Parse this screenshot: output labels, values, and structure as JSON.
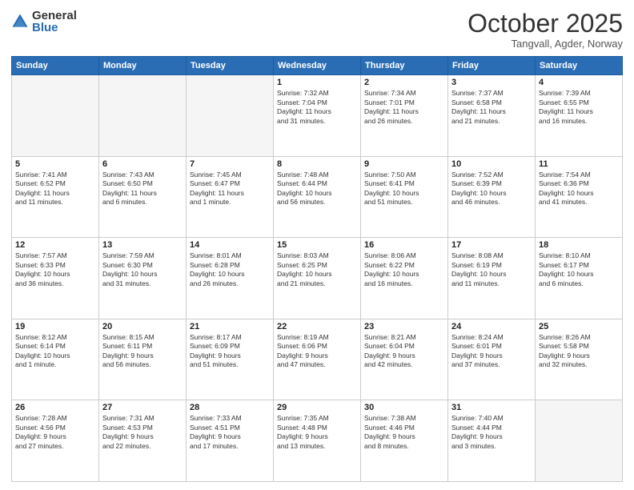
{
  "logo": {
    "general": "General",
    "blue": "Blue"
  },
  "header": {
    "month_year": "October 2025",
    "location": "Tangvall, Agder, Norway"
  },
  "weekdays": [
    "Sunday",
    "Monday",
    "Tuesday",
    "Wednesday",
    "Thursday",
    "Friday",
    "Saturday"
  ],
  "weeks": [
    [
      {
        "day": "",
        "info": ""
      },
      {
        "day": "",
        "info": ""
      },
      {
        "day": "",
        "info": ""
      },
      {
        "day": "1",
        "info": "Sunrise: 7:32 AM\nSunset: 7:04 PM\nDaylight: 11 hours\nand 31 minutes."
      },
      {
        "day": "2",
        "info": "Sunrise: 7:34 AM\nSunset: 7:01 PM\nDaylight: 11 hours\nand 26 minutes."
      },
      {
        "day": "3",
        "info": "Sunrise: 7:37 AM\nSunset: 6:58 PM\nDaylight: 11 hours\nand 21 minutes."
      },
      {
        "day": "4",
        "info": "Sunrise: 7:39 AM\nSunset: 6:55 PM\nDaylight: 11 hours\nand 16 minutes."
      }
    ],
    [
      {
        "day": "5",
        "info": "Sunrise: 7:41 AM\nSunset: 6:52 PM\nDaylight: 11 hours\nand 11 minutes."
      },
      {
        "day": "6",
        "info": "Sunrise: 7:43 AM\nSunset: 6:50 PM\nDaylight: 11 hours\nand 6 minutes."
      },
      {
        "day": "7",
        "info": "Sunrise: 7:45 AM\nSunset: 6:47 PM\nDaylight: 11 hours\nand 1 minute."
      },
      {
        "day": "8",
        "info": "Sunrise: 7:48 AM\nSunset: 6:44 PM\nDaylight: 10 hours\nand 56 minutes."
      },
      {
        "day": "9",
        "info": "Sunrise: 7:50 AM\nSunset: 6:41 PM\nDaylight: 10 hours\nand 51 minutes."
      },
      {
        "day": "10",
        "info": "Sunrise: 7:52 AM\nSunset: 6:39 PM\nDaylight: 10 hours\nand 46 minutes."
      },
      {
        "day": "11",
        "info": "Sunrise: 7:54 AM\nSunset: 6:36 PM\nDaylight: 10 hours\nand 41 minutes."
      }
    ],
    [
      {
        "day": "12",
        "info": "Sunrise: 7:57 AM\nSunset: 6:33 PM\nDaylight: 10 hours\nand 36 minutes."
      },
      {
        "day": "13",
        "info": "Sunrise: 7:59 AM\nSunset: 6:30 PM\nDaylight: 10 hours\nand 31 minutes."
      },
      {
        "day": "14",
        "info": "Sunrise: 8:01 AM\nSunset: 6:28 PM\nDaylight: 10 hours\nand 26 minutes."
      },
      {
        "day": "15",
        "info": "Sunrise: 8:03 AM\nSunset: 6:25 PM\nDaylight: 10 hours\nand 21 minutes."
      },
      {
        "day": "16",
        "info": "Sunrise: 8:06 AM\nSunset: 6:22 PM\nDaylight: 10 hours\nand 16 minutes."
      },
      {
        "day": "17",
        "info": "Sunrise: 8:08 AM\nSunset: 6:19 PM\nDaylight: 10 hours\nand 11 minutes."
      },
      {
        "day": "18",
        "info": "Sunrise: 8:10 AM\nSunset: 6:17 PM\nDaylight: 10 hours\nand 6 minutes."
      }
    ],
    [
      {
        "day": "19",
        "info": "Sunrise: 8:12 AM\nSunset: 6:14 PM\nDaylight: 10 hours\nand 1 minute."
      },
      {
        "day": "20",
        "info": "Sunrise: 8:15 AM\nSunset: 6:11 PM\nDaylight: 9 hours\nand 56 minutes."
      },
      {
        "day": "21",
        "info": "Sunrise: 8:17 AM\nSunset: 6:09 PM\nDaylight: 9 hours\nand 51 minutes."
      },
      {
        "day": "22",
        "info": "Sunrise: 8:19 AM\nSunset: 6:06 PM\nDaylight: 9 hours\nand 47 minutes."
      },
      {
        "day": "23",
        "info": "Sunrise: 8:21 AM\nSunset: 6:04 PM\nDaylight: 9 hours\nand 42 minutes."
      },
      {
        "day": "24",
        "info": "Sunrise: 8:24 AM\nSunset: 6:01 PM\nDaylight: 9 hours\nand 37 minutes."
      },
      {
        "day": "25",
        "info": "Sunrise: 8:26 AM\nSunset: 5:58 PM\nDaylight: 9 hours\nand 32 minutes."
      }
    ],
    [
      {
        "day": "26",
        "info": "Sunrise: 7:28 AM\nSunset: 4:56 PM\nDaylight: 9 hours\nand 27 minutes."
      },
      {
        "day": "27",
        "info": "Sunrise: 7:31 AM\nSunset: 4:53 PM\nDaylight: 9 hours\nand 22 minutes."
      },
      {
        "day": "28",
        "info": "Sunrise: 7:33 AM\nSunset: 4:51 PM\nDaylight: 9 hours\nand 17 minutes."
      },
      {
        "day": "29",
        "info": "Sunrise: 7:35 AM\nSunset: 4:48 PM\nDaylight: 9 hours\nand 13 minutes."
      },
      {
        "day": "30",
        "info": "Sunrise: 7:38 AM\nSunset: 4:46 PM\nDaylight: 9 hours\nand 8 minutes."
      },
      {
        "day": "31",
        "info": "Sunrise: 7:40 AM\nSunset: 4:44 PM\nDaylight: 9 hours\nand 3 minutes."
      },
      {
        "day": "",
        "info": ""
      }
    ]
  ]
}
